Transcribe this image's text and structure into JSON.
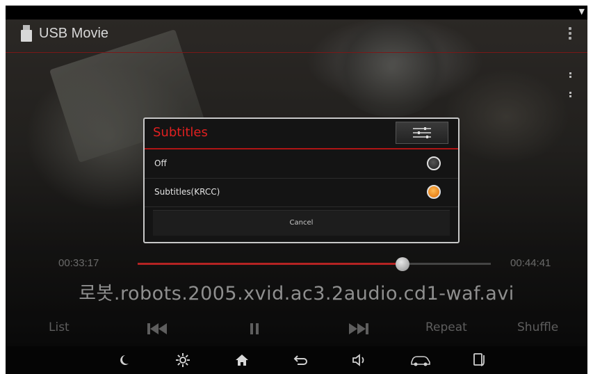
{
  "app": {
    "title": "USB Movie",
    "accent_color": "#e02020",
    "icons": {
      "app": "usb-icon",
      "menu": "more-vert-icon",
      "status": "wifi-icon"
    }
  },
  "player": {
    "time_current": "00:33:17",
    "time_total": "00:44:41",
    "progress": 0.75,
    "filename": "로봇.robots.2005.xvid.ac3.2audio.cd1-waf.avi"
  },
  "controls": {
    "list": "List",
    "prev_icon": "skip-previous-icon",
    "pause_icon": "pause-icon",
    "next_icon": "skip-next-icon",
    "repeat": "Repeat",
    "shuffle": "Shuffle"
  },
  "dialog": {
    "title": "Subtitles",
    "settings_icon": "sliders-icon",
    "options": [
      {
        "label": "Off",
        "selected": false
      },
      {
        "label": "Subtitles(KRCC)",
        "selected": true
      }
    ],
    "cancel": "Cancel"
  },
  "nav_bar": {
    "icons": [
      "night-mode-icon",
      "brightness-icon",
      "home-icon",
      "back-icon",
      "volume-icon",
      "car-icon",
      "phone-projection-icon"
    ]
  }
}
